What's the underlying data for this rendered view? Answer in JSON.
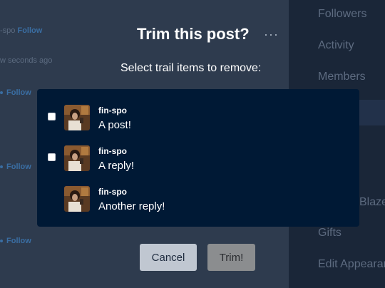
{
  "background": {
    "sidebar_items": [
      "Followers",
      "Activity",
      "Members",
      "Blaze",
      "Gifts",
      "Edit Appearance"
    ],
    "feed": {
      "user_fragment": "-spo",
      "follow_label": "Follow",
      "timestamp_fragment": "w seconds ago"
    }
  },
  "dialog": {
    "title": "Trim this post?",
    "more_icon": "···",
    "subtitle": "Select trail items to remove:",
    "trail_items": [
      {
        "username": "fin-spo",
        "text": "A post!",
        "has_checkbox": true
      },
      {
        "username": "fin-spo",
        "text": "A reply!",
        "has_checkbox": true
      },
      {
        "username": "fin-spo",
        "text": "Another reply!",
        "has_checkbox": false
      }
    ],
    "cancel_label": "Cancel",
    "trim_label": "Trim!"
  },
  "colors": {
    "panel": "#001935",
    "cancel_bg": "#c0c7d1",
    "trim_bg": "#8b8d8f",
    "follow": "#3a6ea3"
  }
}
